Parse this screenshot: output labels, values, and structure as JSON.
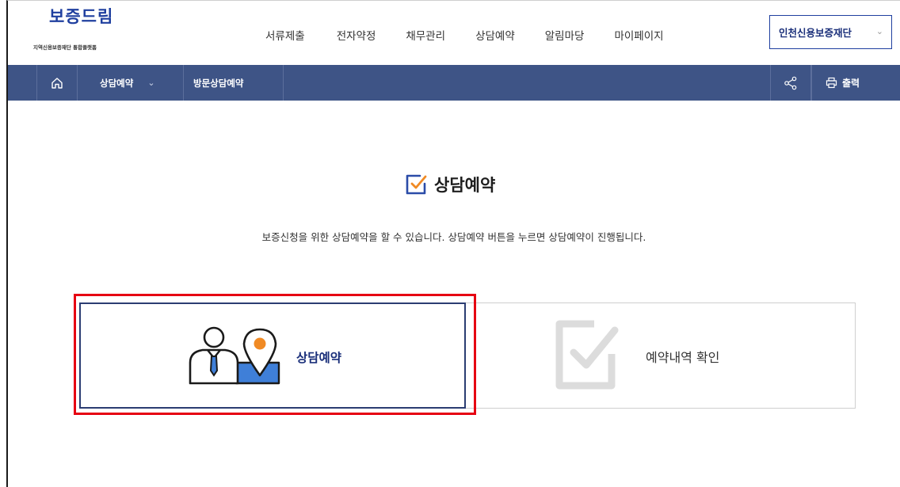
{
  "brand": {
    "name": "보증드림",
    "subtitle": "지역신용보증재단 통합플랫폼"
  },
  "gnb": {
    "items": [
      {
        "label": "서류제출"
      },
      {
        "label": "전자약정"
      },
      {
        "label": "채무관리"
      },
      {
        "label": "상담예약"
      },
      {
        "label": "알림마당"
      },
      {
        "label": "마이페이지"
      }
    ],
    "org_select": "인천신용보증재단"
  },
  "location": {
    "depth1": "상담예약",
    "depth2": "방문상담예약",
    "print_label": "출력"
  },
  "main": {
    "title": "상담예약",
    "description": "보증신청을 위한 상담예약을 할 수 있습니다. 상담예약 버튼을 누르면 상담예약이 진행됩니다.",
    "cards": [
      {
        "label": "상담예약",
        "icon": "consult-people-icon"
      },
      {
        "label": "예약내역 확인",
        "icon": "check-box-icon"
      }
    ]
  },
  "colors": {
    "brand_blue": "#1f3f9f",
    "nav_bar": "#3e5486",
    "accent_orange": "#f08a24",
    "highlight_red": "#e60012"
  }
}
